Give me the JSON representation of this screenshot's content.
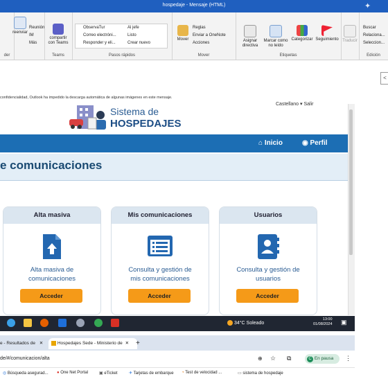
{
  "window": {
    "title": "hospedaje  -  Mensaje (HTML)"
  },
  "ribbon": {
    "groups": [
      {
        "label": "der",
        "items": []
      },
      {
        "label": "",
        "items": [
          "Reunión",
          "IM",
          "Más"
        ],
        "big": "reenviar"
      },
      {
        "label": "Teams",
        "big": "compartir con Teams"
      },
      {
        "label": "Pasos rápidos",
        "items": [
          "ObservaTur",
          "Correo electróni...",
          "Responder y eli...",
          "Al jefe",
          "Listo",
          "Crear nuevo"
        ]
      },
      {
        "label": "Mover",
        "big": "Mover",
        "items": [
          "Reglas",
          "Enviar a OneNote",
          "Acciones"
        ]
      },
      {
        "label": "Etiquetas",
        "items": [
          "Asignar directiva",
          "Marcar como no leído",
          "Categorizar",
          "Seguimiento"
        ]
      },
      {
        "label": "",
        "big": "Traducir"
      },
      {
        "label": "Edición",
        "items": [
          "Buscar",
          "Relaciona...",
          "Seleccion..."
        ]
      }
    ]
  },
  "message": {
    "notice": "confidencialidad, Outlook ha impedido la descarga automática de algunas imágenes en este mensaje.",
    "side_button": "<"
  },
  "site": {
    "logo_title_line1": "Sistema de",
    "logo_title_line2": "HOSPEDAJES",
    "header_user": "Castellano ▾     Salir",
    "nav": {
      "inicio": "Inicio",
      "perfil": "Perfil"
    },
    "section_title": "e comunicaciones",
    "cards": [
      {
        "title": "Alta masiva",
        "desc1": "Alta masiva de",
        "desc2": "comunicaciones",
        "button": "Acceder"
      },
      {
        "title": "Mis comunicaciones",
        "desc1": "Consulta y gestión de",
        "desc2": "mis comunicaciones",
        "button": "Acceder"
      },
      {
        "title": "Usuarios",
        "desc1": "Consulta y gestión de",
        "desc2": "usuarios",
        "button": "Acceder"
      }
    ]
  },
  "taskbar": {
    "weather": "34°C  Soleado",
    "time": "13:00",
    "date": "01/08/2024"
  },
  "browser": {
    "tabs": [
      "e - Resultados de",
      "Hospedajes Sede - Ministerio de"
    ],
    "url": "de/#/comunicacion/alta",
    "profile": "En pausa",
    "bookmarks": [
      "Búsqueda asegurad...",
      "One Net Portal",
      "eTicket",
      "Tarjetas de embarque",
      "Test de velocidad ...",
      "sistema de hospedaje"
    ]
  },
  "colors": {
    "outlook_blue": "#1f5fbf",
    "site_nav": "#1c6eb4",
    "button_orange": "#f59a18",
    "title_blue": "#1a4a72"
  }
}
